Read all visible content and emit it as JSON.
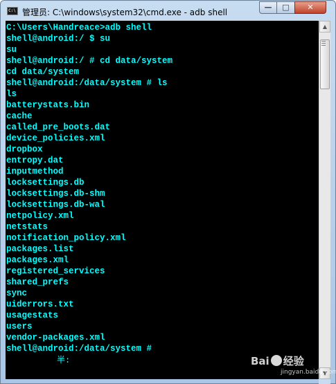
{
  "window": {
    "title": "管理员: C:\\windows\\system32\\cmd.exe - adb  shell",
    "icon": "cmd-icon",
    "controls": {
      "minimize": "—",
      "maximize": "□",
      "close": "✕"
    }
  },
  "console": {
    "text_color": "#00ffff",
    "background": "#000000",
    "lines": [
      "C:\\Users\\Handreace>adb shell",
      "shell@android:/ $ su",
      "su",
      "shell@android:/ # cd data/system",
      "cd data/system",
      "shell@android:/data/system # ls",
      "ls",
      "batterystats.bin",
      "cache",
      "called_pre_boots.dat",
      "device_policies.xml",
      "dropbox",
      "entropy.dat",
      "inputmethod",
      "locksettings.db",
      "locksettings.db-shm",
      "locksettings.db-wal",
      "netpolicy.xml",
      "netstats",
      "notification_policy.xml",
      "packages.list",
      "packages.xml",
      "registered_services",
      "shared_prefs",
      "sync",
      "uiderrors.txt",
      "usagestats",
      "users",
      "vendor-packages.xml",
      "shell@android:/data/system #"
    ],
    "ime_indicator": "半:"
  },
  "watermark": {
    "text_left": "Bai",
    "text_right": "经验",
    "sub": "jingyan.baidu.com"
  }
}
